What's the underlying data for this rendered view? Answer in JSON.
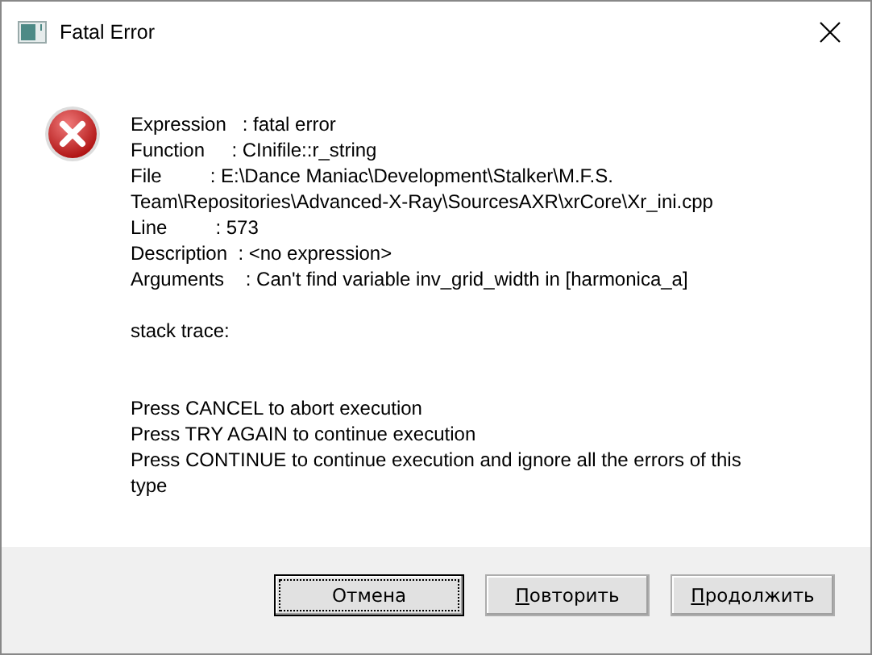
{
  "window": {
    "title": "Fatal Error"
  },
  "message": {
    "details": [
      "Expression   : fatal error",
      "Function     : CInifile::r_string",
      "File         : E:\\Dance Maniac\\Development\\Stalker\\M.F.S. Team\\Repositories\\Advanced-X-Ray\\SourcesAXR\\xrCore\\Xr_ini.cpp",
      "Line         : 573",
      "Description  : <no expression>",
      "Arguments    : Can't find variable inv_grid_width in [harmonica_a]"
    ],
    "trace": "stack trace:",
    "instructions": [
      "Press CANCEL to abort execution",
      "Press TRY AGAIN to continue execution",
      "Press CONTINUE to continue execution and ignore all the errors of this type"
    ]
  },
  "buttons": [
    {
      "label": "Отмена",
      "focused": true,
      "mnemonic": false
    },
    {
      "label": "Повторить",
      "focused": false,
      "mnemonic": true
    },
    {
      "label": "Продолжить",
      "focused": false,
      "mnemonic": true
    }
  ]
}
